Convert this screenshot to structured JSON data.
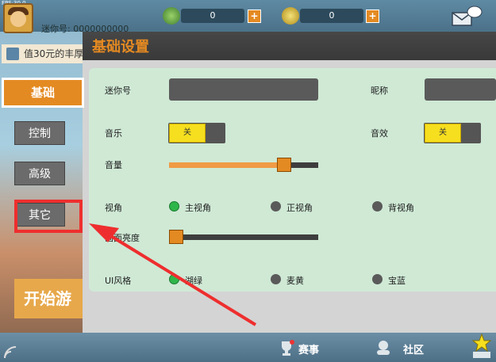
{
  "topbar": {
    "fps_text": "FPS:30.0",
    "counter_1_value": "0",
    "counter_2_value": "0",
    "plus_label": "+"
  },
  "lobby": {
    "userid_text": "迷你号: 0000000000",
    "promo_text": "值30元的丰厚",
    "start_button": "开始游",
    "bottom_items": [
      "赛事",
      "社区"
    ]
  },
  "sidebar": {
    "tabs": [
      {
        "label": "基础",
        "selected": true
      },
      {
        "label": "控制",
        "selected": false
      },
      {
        "label": "高级",
        "selected": false
      },
      {
        "label": "其它",
        "selected": false,
        "highlighted": true
      }
    ]
  },
  "panel": {
    "title": "基础设置",
    "mini_id_label": "迷你号",
    "nickname_label": "昵称",
    "music_label": "音乐",
    "music_toggle": "关",
    "sfx_label": "音效",
    "sfx_toggle": "关",
    "volume_label": "音量",
    "volume_level": 0.77,
    "view_label": "视角",
    "view_options": [
      {
        "label": "主视角",
        "selected": true
      },
      {
        "label": "正视角",
        "selected": false
      },
      {
        "label": "背视角",
        "selected": false
      }
    ],
    "brightness_label": "画面亮度",
    "brightness_level": 0.02,
    "ui_style_label": "UI风格",
    "ui_style_options": [
      {
        "label": "湖绿",
        "selected": true
      },
      {
        "label": "麦黄",
        "selected": false
      },
      {
        "label": "宝蓝",
        "selected": false
      }
    ]
  },
  "colors": {
    "accent": "#e48a22",
    "annotation_red": "#ee2e2e",
    "panel_body": "#cfe9d5",
    "selected_radio": "#2fb64a",
    "toggle_yellow": "#f6df1e"
  },
  "icons": [
    "gem-icon",
    "coin-icon",
    "plus-icon",
    "mail-icon",
    "speaker-icon",
    "trophy-icon",
    "community-icon",
    "shop-cart-icon",
    "wifi-icon"
  ]
}
